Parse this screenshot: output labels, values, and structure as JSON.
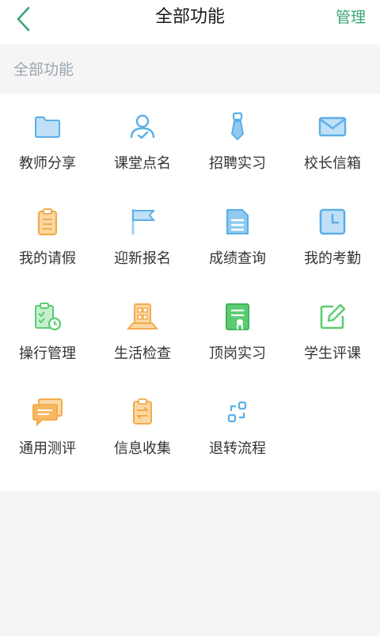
{
  "header": {
    "title": "全部功能",
    "manage_label": "管理"
  },
  "section": {
    "label": "全部功能"
  },
  "colors": {
    "accent": "#3aa876",
    "blue": "#5bafe6",
    "orange": "#f2ab4c",
    "green": "#5ccc73"
  },
  "grid": {
    "items": [
      {
        "label": "教师分享",
        "icon": "folder-icon"
      },
      {
        "label": "课堂点名",
        "icon": "user-check-icon"
      },
      {
        "label": "招聘实习",
        "icon": "necktie-icon"
      },
      {
        "label": "校长信箱",
        "icon": "envelope-icon"
      },
      {
        "label": "我的请假",
        "icon": "clipboard-list-icon"
      },
      {
        "label": "迎新报名",
        "icon": "flag-icon"
      },
      {
        "label": "成绩查询",
        "icon": "document-icon"
      },
      {
        "label": "我的考勤",
        "icon": "clock-icon"
      },
      {
        "label": "操行管理",
        "icon": "clipboard-clock-icon"
      },
      {
        "label": "生活检查",
        "icon": "building-icon"
      },
      {
        "label": "顶岗实习",
        "icon": "certificate-icon"
      },
      {
        "label": "学生评课",
        "icon": "edit-icon"
      },
      {
        "label": "通用测评",
        "icon": "chat-icon"
      },
      {
        "label": "信息收集",
        "icon": "clipboard-transfer-icon"
      },
      {
        "label": "退转流程",
        "icon": "flow-icon"
      }
    ]
  }
}
